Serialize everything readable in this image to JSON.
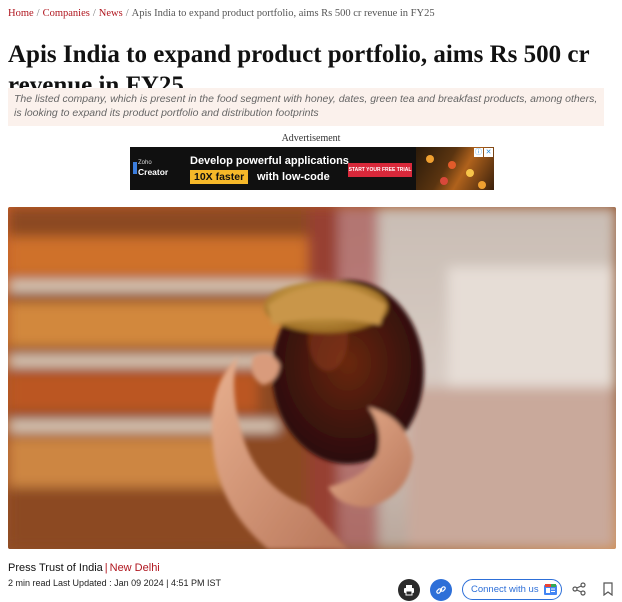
{
  "breadcrumb": {
    "items": [
      "Home",
      "Companies",
      "News"
    ],
    "current": "Apis India to expand product portfolio, aims Rs 500 cr revenue in FY25"
  },
  "article": {
    "title": "Apis India to expand product portfolio, aims Rs 500 cr revenue in FY25",
    "summary": "The listed company, which is present in the food segment with honey, dates, green tea and breakfast products, among others, is looking to expand its product portfolio and distribution footprints",
    "author": "Press Trust of India",
    "location": "New Delhi",
    "read_time": "2 min read",
    "updated_label": "Last Updated : Jan 09 2024 | 4:51 PM IST"
  },
  "ad": {
    "label": "Advertisement",
    "brand_small": "Zoho",
    "brand": "Creator",
    "headline_1": "Develop powerful applications",
    "highlight": "10X faster",
    "headline_2": "with low-code",
    "cta": "START YOUR FREE TRIAL"
  },
  "actions": {
    "connect_label": "Connect with us"
  },
  "icons": {
    "print": "printer-icon",
    "link": "link-icon",
    "google_news": "google-news-icon",
    "share": "share-icon",
    "bookmark": "bookmark-icon"
  },
  "colors": {
    "accent": "#b0161f",
    "summary_bg": "#fbf1ec",
    "link_blue": "#2d6fd8"
  }
}
